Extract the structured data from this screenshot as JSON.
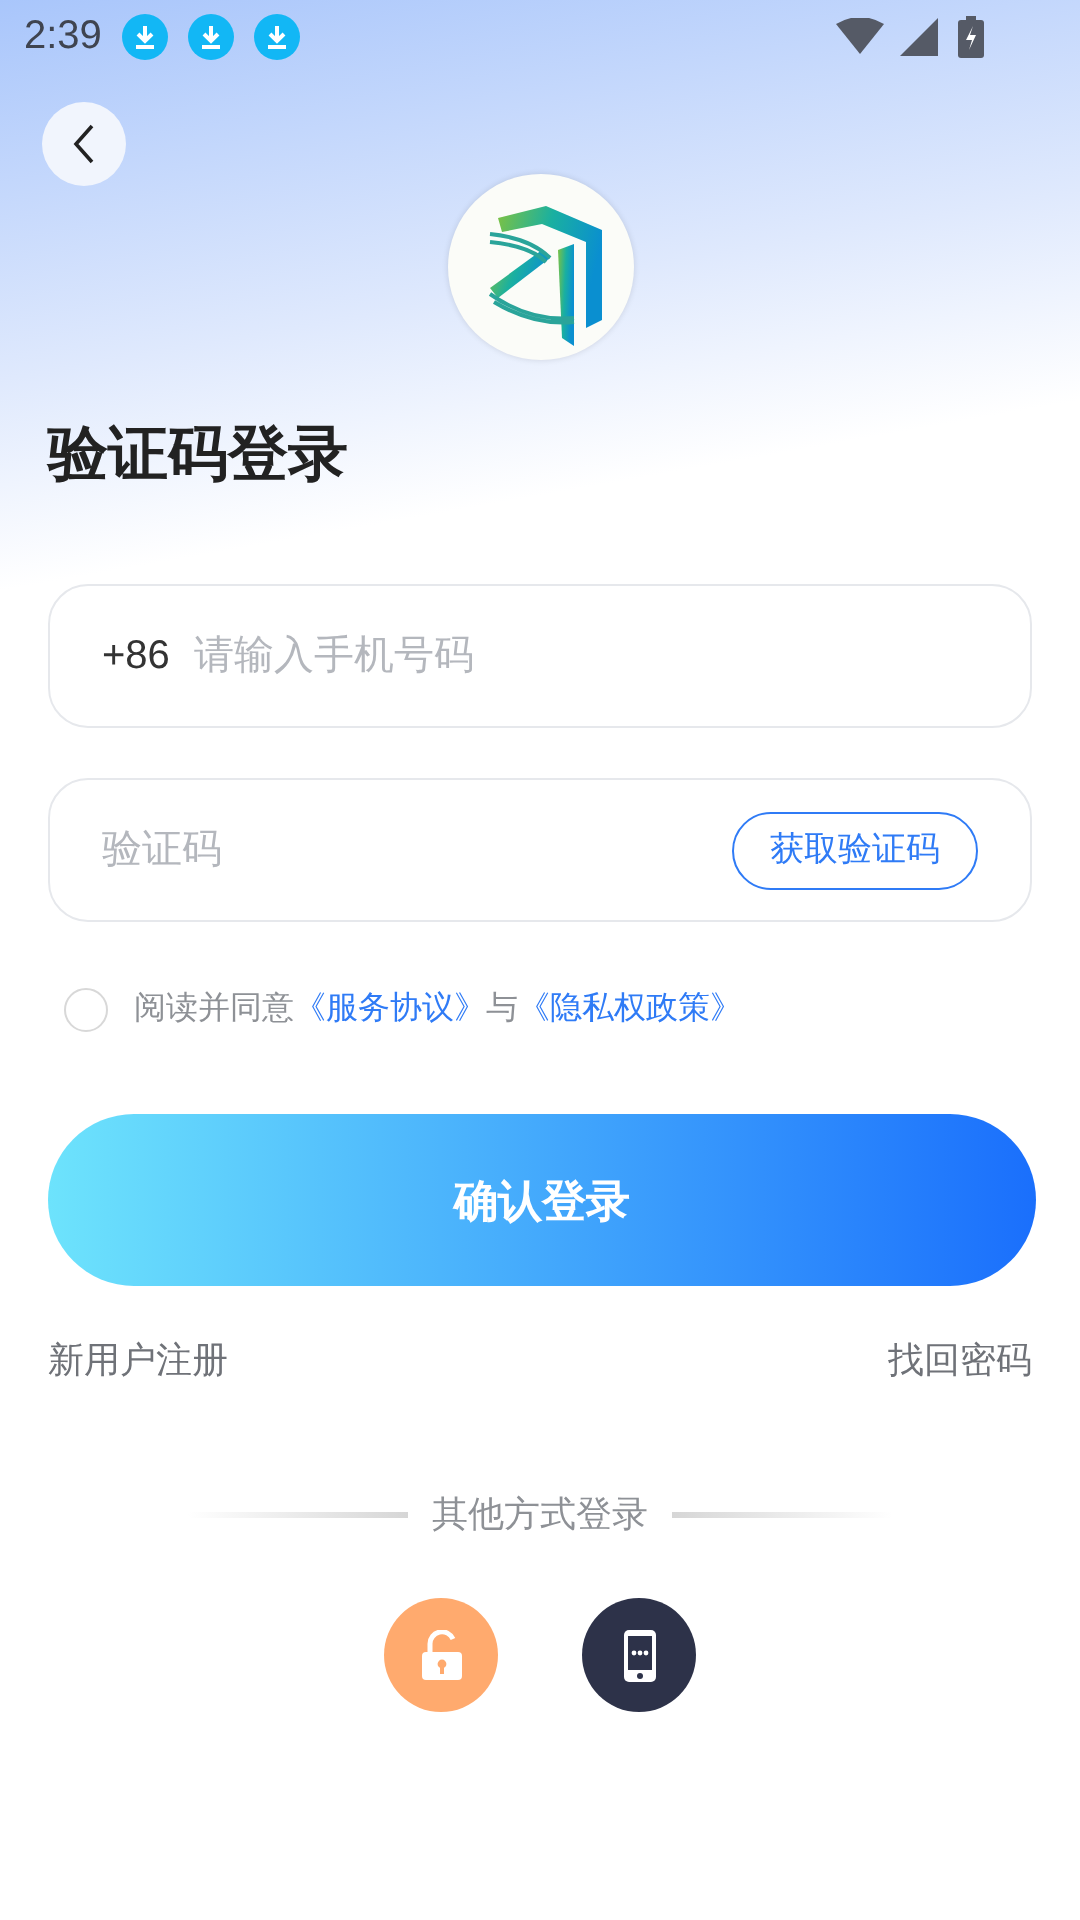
{
  "status_bar": {
    "time": "2:39",
    "notifications": [
      {
        "kind": "download"
      },
      {
        "kind": "download"
      },
      {
        "kind": "download"
      }
    ]
  },
  "title": "验证码登录",
  "phone_field": {
    "prefix": "+86",
    "placeholder": "请输入手机号码"
  },
  "code_field": {
    "placeholder": "验证码",
    "button": "获取验证码"
  },
  "agreement": {
    "checked": false,
    "parts": [
      {
        "kind": "text",
        "text": "阅读并同意"
      },
      {
        "kind": "link",
        "text": "《服务协议》"
      },
      {
        "kind": "text",
        "text": "与"
      },
      {
        "kind": "link",
        "text": "《隐私权政策》"
      }
    ]
  },
  "login_button": "确认登录",
  "links": [
    "新用户注册",
    "找回密码"
  ],
  "other_methods": {
    "label": "其他方式登录",
    "items": [
      {
        "kind": "password"
      },
      {
        "kind": "phone"
      }
    ]
  }
}
